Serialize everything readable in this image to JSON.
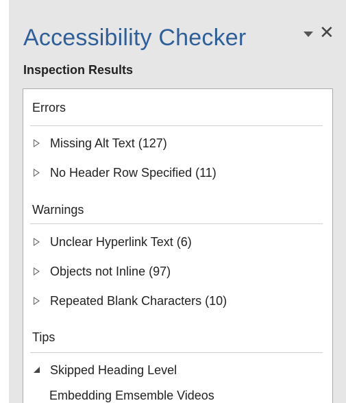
{
  "pane": {
    "title": "Accessibility Checker",
    "dropdown_icon": "chevron-down-icon",
    "close_icon": "close-icon",
    "close_glyph": "✕",
    "subtitle": "Inspection Results"
  },
  "results": {
    "errors": {
      "header": "Errors",
      "items": [
        {
          "label": "Missing Alt Text (127)"
        },
        {
          "label": "No Header Row Specified (11)"
        }
      ]
    },
    "warnings": {
      "header": "Warnings",
      "items": [
        {
          "label": "Unclear Hyperlink Text (6)"
        },
        {
          "label": "Objects not Inline (97)"
        },
        {
          "label": "Repeated Blank Characters (10)"
        }
      ]
    },
    "tips": {
      "header": "Tips",
      "items": [
        {
          "label": "Skipped Heading Level",
          "expanded": true,
          "children": [
            {
              "label": "Embedding Emsemble Videos"
            }
          ]
        }
      ]
    }
  },
  "colors": {
    "title": "#2e5f9a",
    "pane_background": "#e6e6e6",
    "results_background": "#ffffff"
  }
}
